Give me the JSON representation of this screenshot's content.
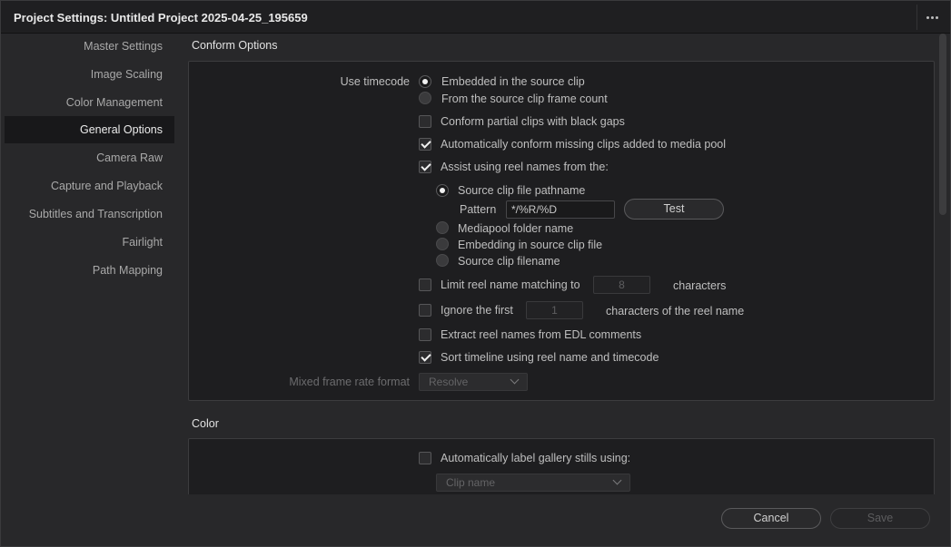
{
  "window": {
    "title": "Project Settings:  Untitled Project 2025-04-25_195659",
    "more_icon": "more-horizontal-icon"
  },
  "sidebar": {
    "items": [
      {
        "label": "Master Settings",
        "active": false
      },
      {
        "label": "Image Scaling",
        "active": false
      },
      {
        "label": "Color Management",
        "active": false
      },
      {
        "label": "General Options",
        "active": true
      },
      {
        "label": "Camera Raw",
        "active": false
      },
      {
        "label": "Capture and Playback",
        "active": false
      },
      {
        "label": "Subtitles and Transcription",
        "active": false
      },
      {
        "label": "Fairlight",
        "active": false
      },
      {
        "label": "Path Mapping",
        "active": false
      }
    ]
  },
  "conform": {
    "section_title": "Conform Options",
    "use_timecode_label": "Use timecode",
    "timecode_options": [
      {
        "label": "Embedded in the source clip",
        "selected": true
      },
      {
        "label": "From the source clip frame count",
        "selected": false
      }
    ],
    "conform_partial": {
      "label": "Conform partial clips with black gaps",
      "checked": false
    },
    "auto_conform": {
      "label": "Automatically conform missing clips added to media pool",
      "checked": true
    },
    "assist_reel": {
      "label": "Assist using reel names from the:",
      "checked": true
    },
    "reel_sources": [
      {
        "label": "Source clip file pathname",
        "selected": true
      },
      {
        "label": "Mediapool folder name",
        "selected": false
      },
      {
        "label": "Embedding in source clip file",
        "selected": false
      },
      {
        "label": "Source clip filename",
        "selected": false
      }
    ],
    "pattern_label": "Pattern",
    "pattern_value": "*/%R/%D",
    "test_button": "Test",
    "limit_reel": {
      "label": "Limit reel name matching to",
      "checked": false,
      "value": "8",
      "suffix": "characters"
    },
    "ignore_first": {
      "label": "Ignore the first",
      "checked": false,
      "value": "1",
      "suffix": "characters of the reel name"
    },
    "extract_edl": {
      "label": "Extract reel names from EDL comments",
      "checked": false
    },
    "sort_timeline": {
      "label": "Sort timeline using reel name and timecode",
      "checked": true
    },
    "mixed_frame_label": "Mixed frame rate format",
    "mixed_frame_value": "Resolve"
  },
  "color": {
    "section_title": "Color",
    "auto_label": {
      "label": "Automatically label gallery stills using:",
      "checked": false
    },
    "label_source": "Clip name"
  },
  "footer": {
    "cancel": "Cancel",
    "save": "Save"
  },
  "colors": {
    "background": "#28282a",
    "panel": "#1e1e20",
    "accent_text": "#ececec"
  }
}
